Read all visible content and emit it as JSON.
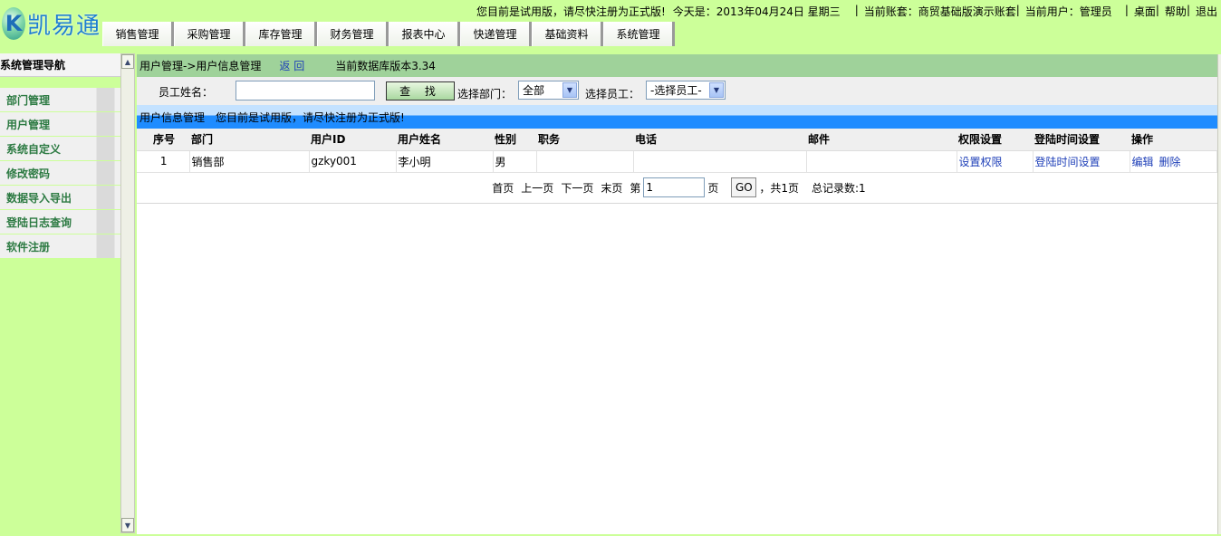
{
  "header": {
    "logo_letter": "K",
    "logo_text": "凯易通",
    "trial_notice": "您目前是试用版，请尽快注册为正式版!",
    "today_label": "今天是：2013年04月24日  星期三",
    "account_label": "当前账套：商贸基础版演示账套",
    "user_label": "当前用户：管理员",
    "desktop": "桌面",
    "help": "帮助",
    "logout": "退出",
    "pipe": "|"
  },
  "menu": [
    "销售管理",
    "采购管理",
    "库存管理",
    "财务管理",
    "报表中心",
    "快递管理",
    "基础资料",
    "系统管理"
  ],
  "sidebar": {
    "title": "系统管理导航",
    "items": [
      "部门管理",
      "用户管理",
      "系统自定义",
      "修改密码",
      "数据导入导出",
      "登陆日志查询",
      "软件注册"
    ]
  },
  "breadcrumb": {
    "path": "用户管理->用户信息管理",
    "back": "返 回",
    "version": "当前数据库版本3.34"
  },
  "search": {
    "name_label": "员工姓名：",
    "name_value": "",
    "search_button": "查 找",
    "dept_label": "选择部门：",
    "dept_value": "全部",
    "emp_label": "选择员工：",
    "emp_value": "-选择员工-"
  },
  "section": {
    "title": "用户信息管理",
    "notice": "您目前是试用版，请尽快注册为正式版!"
  },
  "table": {
    "headers": [
      "序号",
      "部门",
      "用户ID",
      "用户姓名",
      "性别",
      "职务",
      "电话",
      "邮件",
      "权限设置",
      "登陆时间设置",
      "操作"
    ],
    "rows": [
      {
        "no": "1",
        "dept": "销售部",
        "uid": "gzky001",
        "name": "李小明",
        "gender": "男",
        "title": "",
        "phone": "",
        "email": "",
        "perm": "设置权限",
        "login_time": "登陆时间设置",
        "edit": "编辑",
        "delete": "删除"
      }
    ]
  },
  "pager": {
    "first": "首页",
    "prev": "上一页",
    "next": "下一页",
    "last": "末页",
    "page_prefix": "第",
    "page_value": "1",
    "page_suffix": "页",
    "go": "GO",
    "total_pages": "，共1页",
    "total_records": "总记录数:1"
  }
}
